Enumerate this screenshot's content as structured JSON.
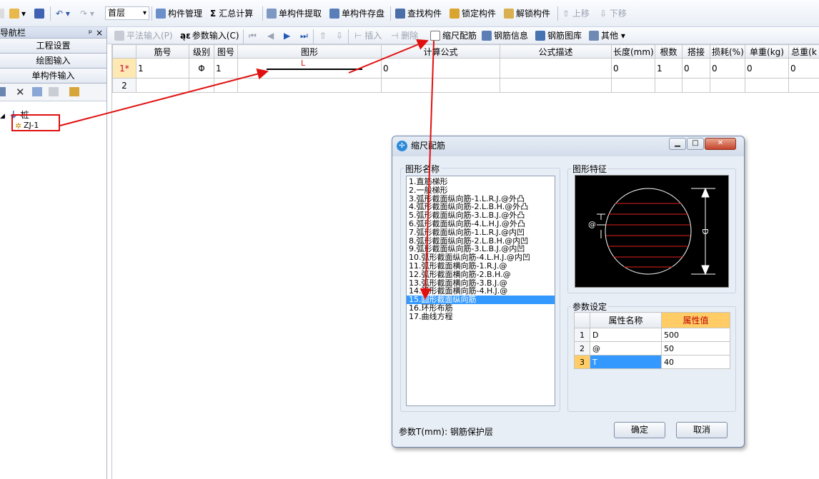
{
  "toolbar": {
    "floor": "首层",
    "items": [
      "构件管理",
      "汇总计算",
      "单构件提取",
      "单构件存盘",
      "查找构件",
      "锁定构件",
      "解锁构件",
      "上移",
      "下移"
    ],
    "sigma": "Σ"
  },
  "nav": {
    "title": "块导航栏",
    "pin": "ᵖ",
    "close": "×",
    "buttons": [
      "工程设置",
      "绘图输入",
      "单构件输入"
    ],
    "tree_root": "桩",
    "tree_child": "ZJ-1"
  },
  "toolbar2": {
    "items": [
      "平法输入(P)",
      "参数输入(C)",
      "插入",
      "删除",
      "缩尺配筋",
      "钢筋信息",
      "钢筋图库",
      "其他"
    ]
  },
  "grid": {
    "headers": [
      "",
      "筋号",
      "级别",
      "图号",
      "图形",
      "计算公式",
      "公式描述",
      "长度(mm)",
      "根数",
      "搭接",
      "损耗(%)",
      "单重(kg)",
      "总重(k"
    ],
    "row1": {
      "rowno": "1*",
      "jinhao": "1",
      "jibie": "Φ",
      "tuhao": "1",
      "shape_label": "L",
      "formula": "0",
      "desc": "",
      "length": "0",
      "count": "1",
      "lap": "0",
      "loss": "0",
      "unit_w": "0",
      "total_w": "0"
    },
    "row2": {
      "rowno": "2"
    }
  },
  "dialog": {
    "title": "缩尺配筋",
    "shape_group": "图形名称",
    "feature_group": "图形特征",
    "param_group": "参数设定",
    "shapes": [
      "1.直筋梯形",
      "2.一般梯形",
      "3.弧形截面纵向筋-1.L.R.J.@外凸",
      "4.弧形截面纵向筋-2.L.B.H.@外凸",
      "5.弧形截面纵向筋-3.L.B.J.@外凸",
      "6.弧形截面纵向筋-4.L.H.J.@外凸",
      "7.弧形截面纵向筋-1.L.R.J.@内凹",
      "8.弧形截面纵向筋-2.L.B.H.@内凹",
      "9.弧形截面纵向筋-3.L.B.J.@内凹",
      "10.弧形截面纵向筋-4.L.H.J.@内凹",
      "11.弧形截面横向筋-1.R.J.@",
      "12.弧形截面横向筋-2.B.H.@",
      "13.弧形截面横向筋-3.B.J.@",
      "14.弧形截面横向筋-4.H.J.@",
      "15.圆形截面纵向筋",
      "16.环形布筋",
      "17.曲线方程"
    ],
    "selected_index": 14,
    "feature_labels": {
      "at": "@",
      "d": "D"
    },
    "params": {
      "col_name": "属性名称",
      "col_value": "属性值",
      "rows": [
        {
          "no": "1",
          "name": "D",
          "value": "500"
        },
        {
          "no": "2",
          "name": "@",
          "value": "50"
        },
        {
          "no": "3",
          "name": "T",
          "value": "40"
        }
      ]
    },
    "hint": "参数T(mm): 钢筋保护层",
    "ok": "确定",
    "cancel": "取消"
  },
  "colors": {
    "annotation": "#e01010",
    "selection": "#3399ff",
    "header_highlight": "#ffcc66"
  }
}
